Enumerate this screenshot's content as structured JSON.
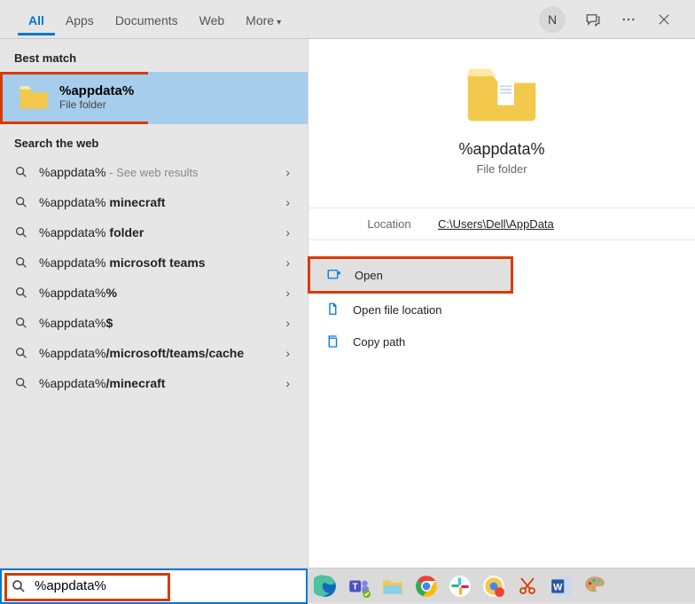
{
  "tabs": {
    "all": "All",
    "apps": "Apps",
    "documents": "Documents",
    "web": "Web",
    "more": "More"
  },
  "avatar_letter": "N",
  "sections": {
    "best_match": "Best match",
    "search_web": "Search the web"
  },
  "best_match": {
    "title": "%appdata%",
    "subtitle": "File folder"
  },
  "web_items": [
    {
      "base": "%appdata%",
      "suffix": "",
      "hint": " - See web results"
    },
    {
      "base": "%appdata%",
      "suffix": " minecraft",
      "hint": ""
    },
    {
      "base": "%appdata%",
      "suffix": " folder",
      "hint": ""
    },
    {
      "base": "%appdata%",
      "suffix": " microsoft teams",
      "hint": ""
    },
    {
      "base": "%appdata%",
      "suffix": "%",
      "hint": ""
    },
    {
      "base": "%appdata%",
      "suffix": "$",
      "hint": ""
    },
    {
      "base": "%appdata%",
      "suffix": "/microsoft/teams/cache",
      "hint": ""
    },
    {
      "base": "%appdata%",
      "suffix": "/minecraft",
      "hint": ""
    }
  ],
  "preview": {
    "title": "%appdata%",
    "subtitle": "File folder",
    "location_label": "Location",
    "location_value": "C:\\Users\\Dell\\AppData"
  },
  "actions": {
    "open": "Open",
    "open_loc": "Open file location",
    "copy_path": "Copy path"
  },
  "search": {
    "value": "%appdata%"
  }
}
